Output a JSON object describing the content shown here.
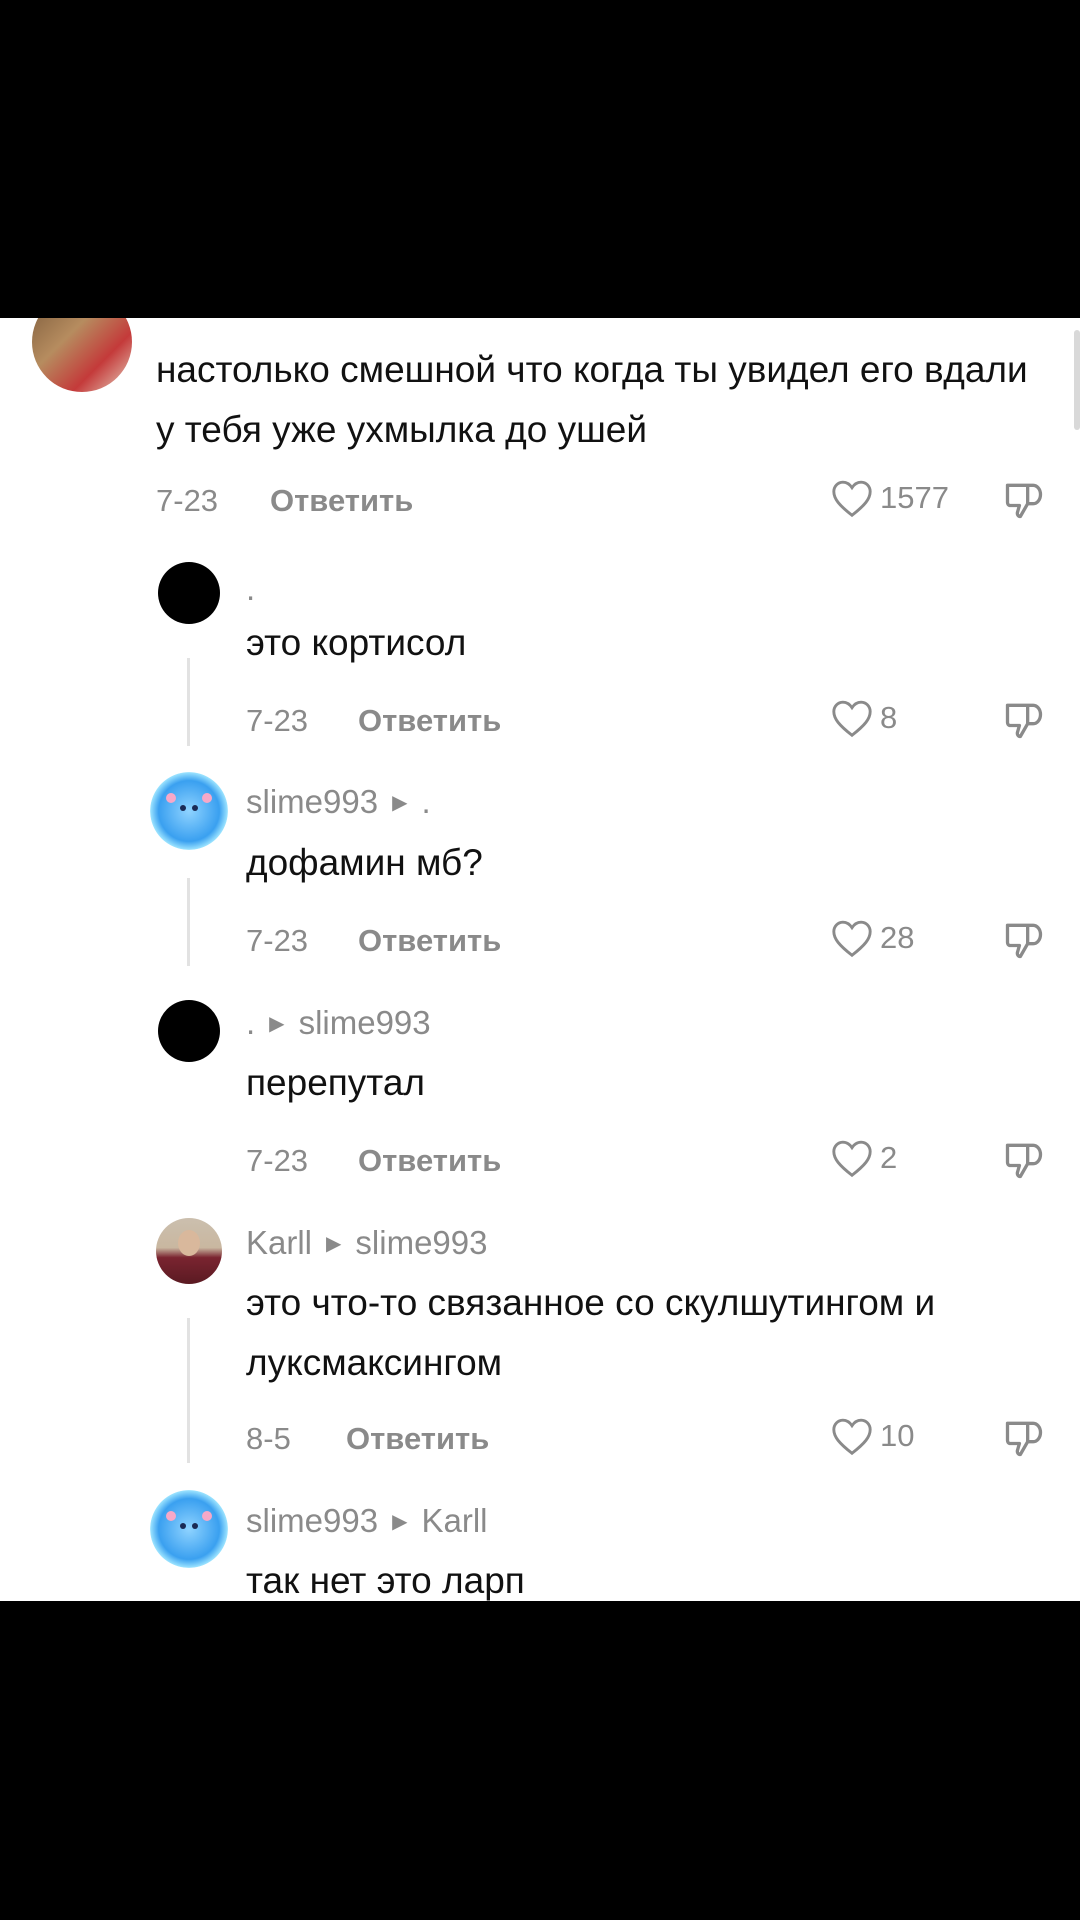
{
  "comments": [
    {
      "name": "",
      "text": "настолько смешной что когда ты увидел его вдали у тебя уже ухмылка до ушей",
      "date": "7-23",
      "reply_label": "Ответить",
      "likes": "1577"
    },
    {
      "name": ".",
      "reply_to": "",
      "text": "это кортисол",
      "date": "7-23",
      "reply_label": "Ответить",
      "likes": "8"
    },
    {
      "name": "slime993",
      "reply_to": ".",
      "text": "дофамин мб?",
      "date": "7-23",
      "reply_label": "Ответить",
      "likes": "28"
    },
    {
      "name": ".",
      "reply_to": "slime993",
      "text": "перепутал",
      "date": "7-23",
      "reply_label": "Ответить",
      "likes": "2"
    },
    {
      "name": "Karll",
      "reply_to": "slime993",
      "text": "это что-то связанное со скулшутингом и луксмаксингом",
      "date": "8-5",
      "reply_label": "Ответить",
      "likes": "10"
    },
    {
      "name": "slime993",
      "reply_to": "Karll",
      "text": "так нет это ларп"
    }
  ]
}
